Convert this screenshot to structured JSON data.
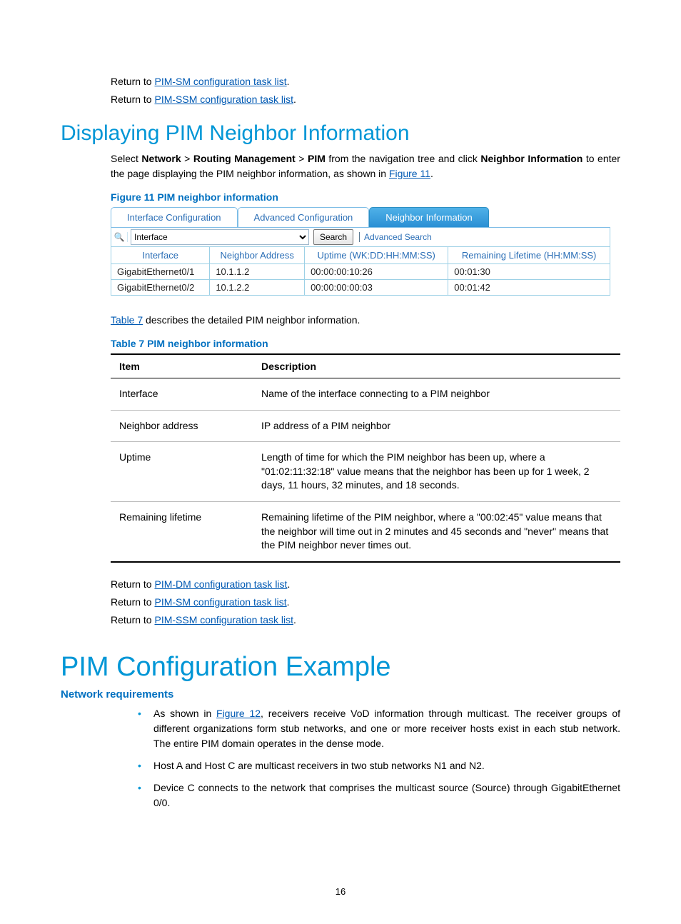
{
  "top_links": {
    "return_prefix": "Return to ",
    "sm_link": "PIM-SM configuration task list",
    "ssm_link": "PIM-SSM configuration task list",
    "dm_link": "PIM-DM configuration task list",
    "period": "."
  },
  "section1": {
    "heading": "Displaying PIM Neighbor Information",
    "intro_plain1": "Select ",
    "nav_1": "Network",
    "gt": " > ",
    "nav_2": "Routing Management",
    "nav_3": "PIM",
    "intro_plain2": " from the navigation tree and click ",
    "nav_4": "Neighbor Information",
    "intro_plain3": " to enter the page displaying the PIM neighbor information, as shown in ",
    "figure_ref": "Figure 11",
    "figure_caption": "Figure 11 PIM neighbor information"
  },
  "ui": {
    "tabs": [
      "Interface Configuration",
      "Advanced Configuration",
      "Neighbor Information"
    ],
    "search_field": "Interface",
    "search_btn": "Search",
    "adv_search": "Advanced Search",
    "columns": [
      "Interface",
      "Neighbor Address",
      "Uptime (WK:DD:HH:MM:SS)",
      "Remaining Lifetime (HH:MM:SS)"
    ],
    "rows": [
      {
        "iface": "GigabitEthernet0/1",
        "addr": "10.1.1.2",
        "uptime": "00:00:00:10:26",
        "remain": "00:01:30"
      },
      {
        "iface": "GigabitEthernet0/2",
        "addr": "10.1.2.2",
        "uptime": "00:00:00:00:03",
        "remain": "00:01:42"
      }
    ]
  },
  "table7": {
    "intro_pre": " describes the detailed PIM neighbor information.",
    "ref": "Table 7",
    "caption": "Table 7 PIM neighbor information",
    "header_item": "Item",
    "header_desc": "Description",
    "rows": [
      {
        "item": "Interface",
        "desc": "Name of the interface connecting to a PIM neighbor"
      },
      {
        "item": "Neighbor address",
        "desc": "IP address of a PIM neighbor"
      },
      {
        "item": "Uptime",
        "desc": "Length of time for which the PIM neighbor has been up, where a \"01:02:11:32:18\" value means that the neighbor has been up for 1 week, 2 days, 11 hours, 32 minutes, and 18 seconds."
      },
      {
        "item": "Remaining lifetime",
        "desc": "Remaining lifetime of the PIM neighbor, where a \"00:02:45\" value means that the neighbor will time out in 2 minutes and 45 seconds and \"never\" means that the PIM neighbor never times out."
      }
    ]
  },
  "section2": {
    "heading": "PIM Configuration Example",
    "subhead": "Network requirements",
    "bullets_pre": "As shown in ",
    "fig12": "Figure 12",
    "b1_post": ", receivers receive VoD information through multicast. The receiver groups of different organizations form stub networks, and one or more receiver hosts exist in each stub network. The entire PIM domain operates in the dense mode.",
    "b2": "Host A and Host C are multicast receivers in two stub networks N1 and N2.",
    "b3": "Device C connects to the network that comprises the multicast source (Source) through GigabitEthernet 0/0."
  },
  "page_number": "16"
}
